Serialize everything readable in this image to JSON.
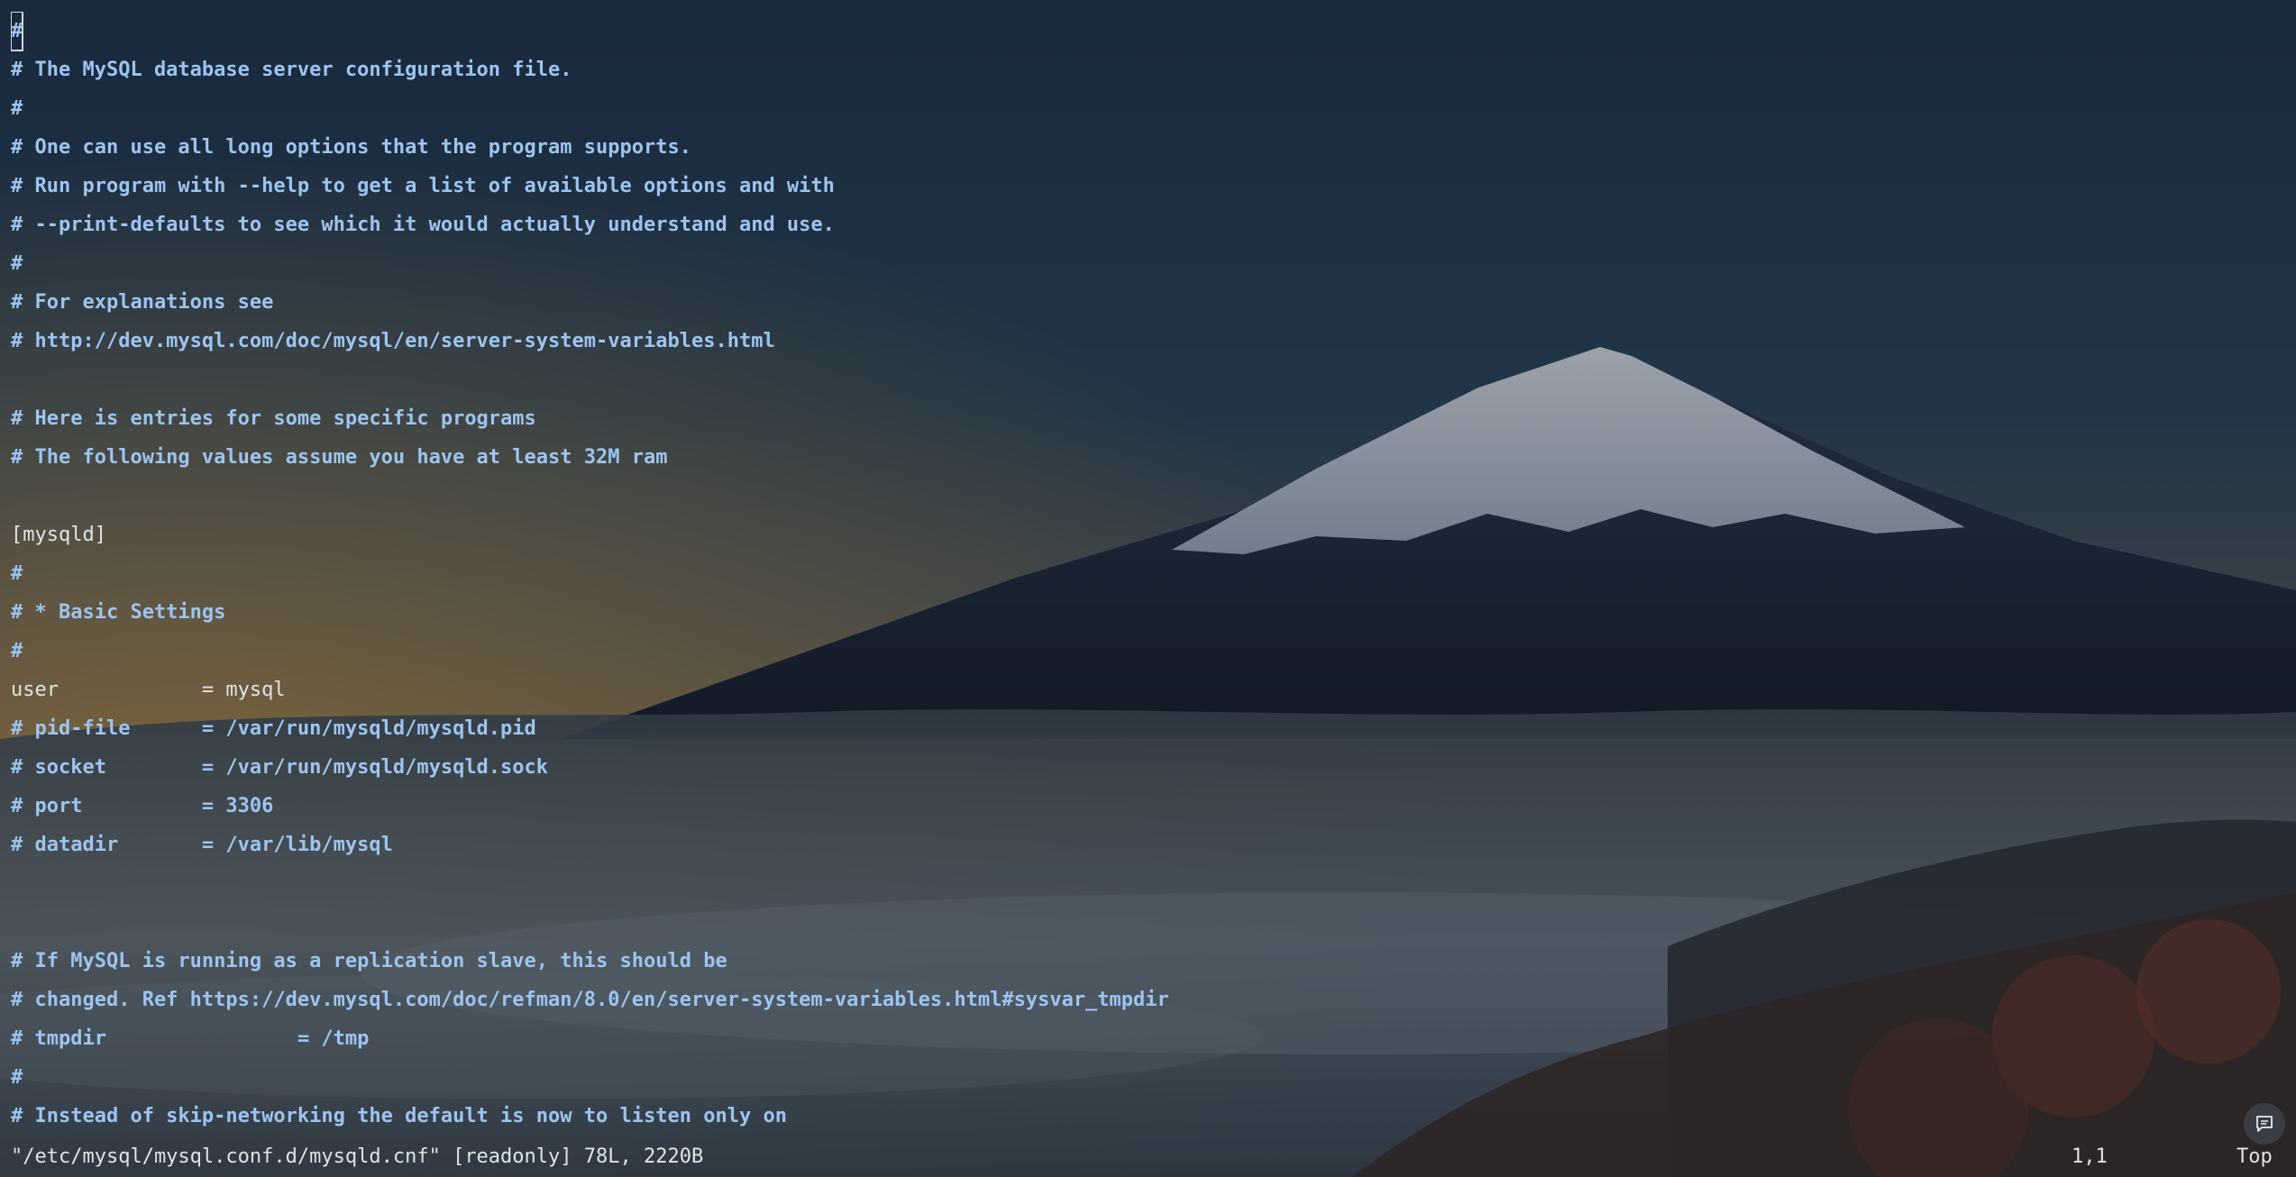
{
  "editor": {
    "cursor_char": "#",
    "lines": [
      {
        "text": "#",
        "type": "comment"
      },
      {
        "text": "# The MySQL database server configuration file.",
        "type": "comment"
      },
      {
        "text": "#",
        "type": "comment"
      },
      {
        "text": "# One can use all long options that the program supports.",
        "type": "comment"
      },
      {
        "text": "# Run program with --help to get a list of available options and with",
        "type": "comment"
      },
      {
        "text": "# --print-defaults to see which it would actually understand and use.",
        "type": "comment"
      },
      {
        "text": "#",
        "type": "comment"
      },
      {
        "text": "# For explanations see",
        "type": "comment"
      },
      {
        "text": "# http://dev.mysql.com/doc/mysql/en/server-system-variables.html",
        "type": "comment"
      },
      {
        "text": "",
        "type": "plain"
      },
      {
        "text": "# Here is entries for some specific programs",
        "type": "comment"
      },
      {
        "text": "# The following values assume you have at least 32M ram",
        "type": "comment"
      },
      {
        "text": "",
        "type": "plain"
      },
      {
        "text": "[mysqld]",
        "type": "plain"
      },
      {
        "text": "#",
        "type": "comment"
      },
      {
        "text": "# * Basic Settings",
        "type": "comment"
      },
      {
        "text": "#",
        "type": "comment"
      },
      {
        "text": "user            = mysql",
        "type": "plain"
      },
      {
        "text": "# pid-file      = /var/run/mysqld/mysqld.pid",
        "type": "comment"
      },
      {
        "text": "# socket        = /var/run/mysqld/mysqld.sock",
        "type": "comment"
      },
      {
        "text": "# port          = 3306",
        "type": "comment"
      },
      {
        "text": "# datadir       = /var/lib/mysql",
        "type": "comment"
      },
      {
        "text": "",
        "type": "plain"
      },
      {
        "text": "",
        "type": "plain"
      },
      {
        "text": "# If MySQL is running as a replication slave, this should be",
        "type": "comment"
      },
      {
        "text": "# changed. Ref https://dev.mysql.com/doc/refman/8.0/en/server-system-variables.html#sysvar_tmpdir",
        "type": "comment"
      },
      {
        "text": "# tmpdir                = /tmp",
        "type": "comment"
      },
      {
        "text": "#",
        "type": "comment"
      },
      {
        "text": "# Instead of skip-networking the default is now to listen only on",
        "type": "comment"
      }
    ]
  },
  "status": {
    "message": "\"/etc/mysql/mysql.conf.d/mysqld.cnf\" [readonly] 78L, 2220B",
    "position": "1,1",
    "scroll": "Top"
  },
  "icons": {
    "chat": "chat-bubble-icon"
  },
  "colors": {
    "comment": "#9cc4ef",
    "plain": "#dfe3e7",
    "sky_top": "#1f3349",
    "horizon_glow": "#b98e45"
  }
}
